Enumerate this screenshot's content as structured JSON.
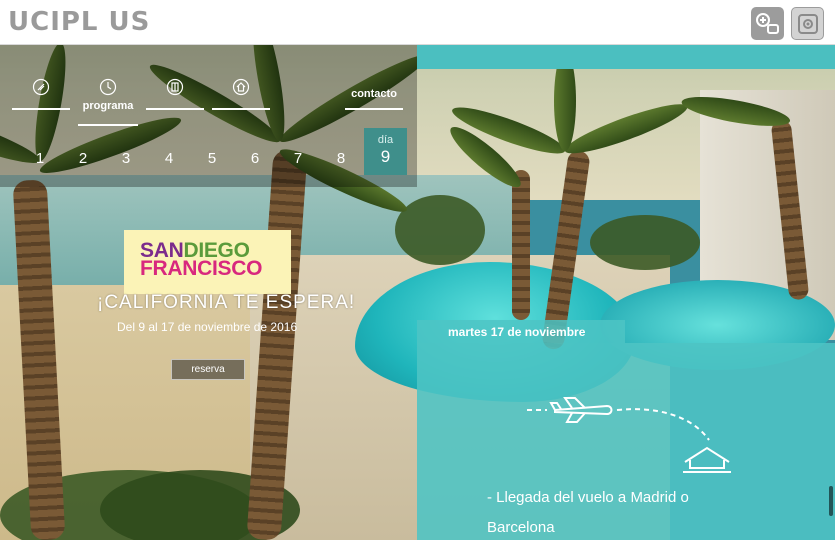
{
  "app": {
    "logo": "UCIPL US"
  },
  "nav": {
    "items": [
      {
        "id": "plane",
        "label": ""
      },
      {
        "id": "programa",
        "label": "programa"
      },
      {
        "id": "hotel",
        "label": ""
      },
      {
        "id": "home",
        "label": ""
      },
      {
        "id": "contacto",
        "label": "contacto"
      }
    ],
    "day_label": "día",
    "days": [
      "1",
      "2",
      "3",
      "4",
      "5",
      "6",
      "7",
      "8"
    ],
    "active_day": "9"
  },
  "hero": {
    "badge_line1_a": "SAN",
    "badge_line1_b": "DIEGO",
    "badge_line2": "FRANCISCO",
    "tagline": "¡CALIFORNIA TE ESPERA!",
    "dates": "Del 9 al 17 de noviembre de 2016",
    "reserve_label": "reserva"
  },
  "itinerary": {
    "date": "martes 17 de noviembre",
    "text": "- Llegada del vuelo a Madrid o Barcelona"
  },
  "colors": {
    "teal": "#4bbfc0",
    "badge_bg": "#fbf3b7",
    "badge_purple": "#7b2b8c",
    "badge_green": "#5b9b3b",
    "badge_pink": "#d8287e"
  }
}
